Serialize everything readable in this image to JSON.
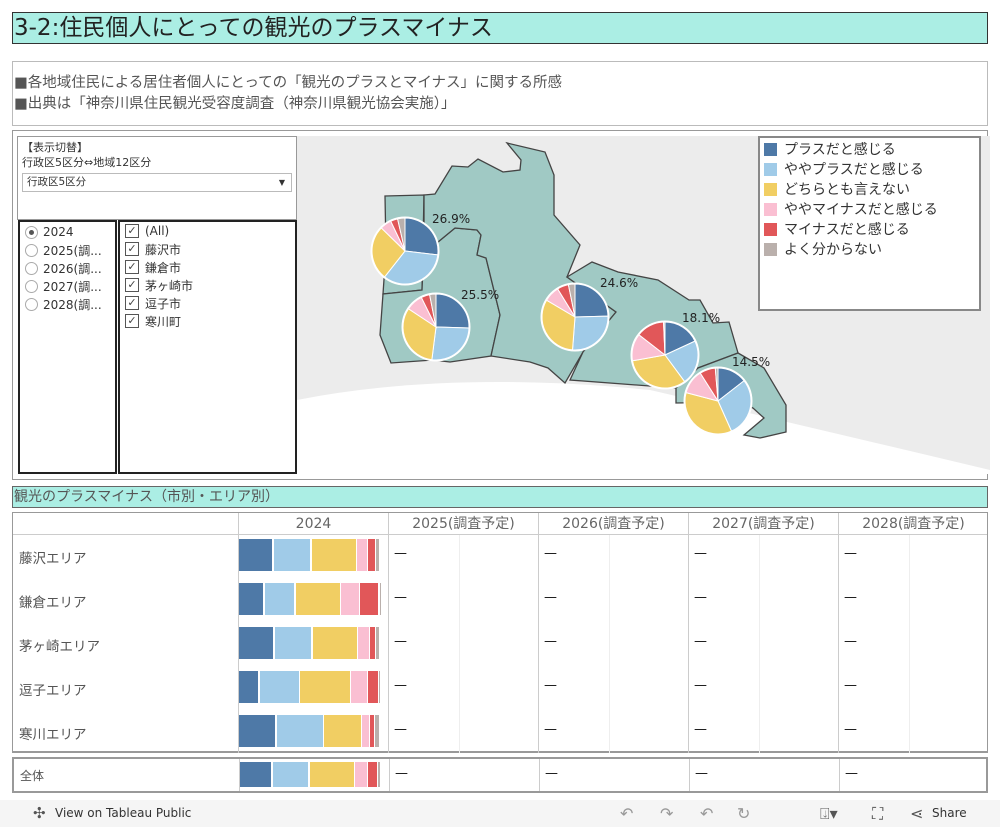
{
  "title": "3-2:住民個人にとっての観光のプラスマイナス",
  "subtitle": [
    "■各地域住民による居住者個人にとっての「観光のプラスとマイナス」に関する所感",
    "■出典は「神奈川県住民観光受容度調査（神奈川県観光協会実施）」"
  ],
  "filter": {
    "label1": "【表示切替】",
    "label2": "行政区5区分⇔地域12区分",
    "dropdown_value": "行政区5区分"
  },
  "years": [
    {
      "label": "2024",
      "selected": true
    },
    {
      "label": "2025(調...",
      "selected": false
    },
    {
      "label": "2026(調...",
      "selected": false
    },
    {
      "label": "2027(調...",
      "selected": false
    },
    {
      "label": "2028(調...",
      "selected": false
    }
  ],
  "cities": [
    {
      "label": "(All)",
      "checked": true
    },
    {
      "label": "藤沢市",
      "checked": true
    },
    {
      "label": "鎌倉市",
      "checked": true
    },
    {
      "label": "茅ヶ崎市",
      "checked": true
    },
    {
      "label": "逗子市",
      "checked": true
    },
    {
      "label": "寒川町",
      "checked": true
    }
  ],
  "legend": [
    {
      "label": "プラスだと感じる",
      "color": "#4e79a7"
    },
    {
      "label": "ややプラスだと感じる",
      "color": "#a0cbe8"
    },
    {
      "label": "どちらとも言えない",
      "color": "#f1ce63"
    },
    {
      "label": "ややマイナスだと感じる",
      "color": "#fabfd2"
    },
    {
      "label": "マイナスだと感じる",
      "color": "#e15759"
    },
    {
      "label": "よく分からない",
      "color": "#bab0ac"
    }
  ],
  "map_colors": {
    "region_fill": "#a0c9c4",
    "region_stroke": "#444",
    "background": "#ececec"
  },
  "pies": [
    {
      "label": "26.9%",
      "values": [
        26.9,
        33.7,
        26.7,
        5.6,
        3.5,
        3.6
      ]
    },
    {
      "label": "25.5%",
      "values": [
        25.5,
        26.5,
        32.3,
        8.4,
        4.2,
        3.1
      ]
    },
    {
      "label": "24.6%",
      "values": [
        24.6,
        26.6,
        32.3,
        7.7,
        5.6,
        3.2
      ]
    },
    {
      "label": "18.1%",
      "values": [
        18.1,
        21.8,
        32.3,
        13.3,
        13.8,
        0.7
      ]
    },
    {
      "label": "14.5%",
      "values": [
        14.5,
        28.8,
        35.8,
        11.9,
        7.7,
        1.3
      ]
    }
  ],
  "section_title": "観光のプラスマイナス（市別・エリア別）",
  "table": {
    "columns": [
      "2024",
      "2025(調査予定)",
      "2026(調査予定)",
      "2027(調査予定)",
      "2028(調査予定)"
    ],
    "empty_value": "—",
    "rows": [
      {
        "label": "藤沢エリア",
        "values": [
          24.4,
          26.7,
          32.3,
          7.7,
          5.6,
          3.3
        ]
      },
      {
        "label": "鎌倉エリア",
        "values": [
          18.0,
          21.8,
          32.3,
          13.3,
          13.8,
          0.7
        ]
      },
      {
        "label": "茅ヶ崎エリア",
        "values": [
          25.1,
          26.7,
          32.3,
          8.4,
          4.2,
          3.3
        ]
      },
      {
        "label": "逗子エリア",
        "values": [
          14.5,
          28.8,
          35.8,
          11.9,
          7.7,
          1.3
        ]
      },
      {
        "label": "寒川エリア",
        "values": [
          26.5,
          33.7,
          26.7,
          5.6,
          3.5,
          4.0
        ]
      }
    ],
    "total": {
      "label": "全体",
      "values": [
        23.0,
        26.0,
        32.3,
        9.1,
        6.8,
        2.8
      ]
    }
  },
  "footer": {
    "view_label": "View on Tableau Public",
    "share_label": "Share"
  }
}
